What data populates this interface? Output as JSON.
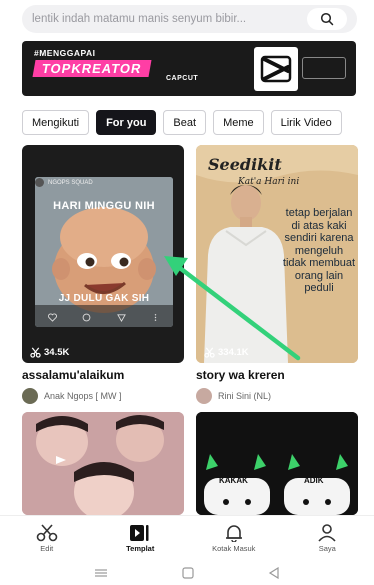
{
  "search": {
    "placeholder": "lentik indah matamu manis senyum bibir..."
  },
  "banner": {
    "hashtag": "#MENGGAPAI",
    "title": "TOPKREATOR",
    "brand": "CAPCUT"
  },
  "tabs": [
    {
      "label": "Mengikuti",
      "active": false
    },
    {
      "label": "For you",
      "active": true
    },
    {
      "label": "Beat",
      "active": false
    },
    {
      "label": "Meme",
      "active": false
    },
    {
      "label": "Lirik Video",
      "active": false
    }
  ],
  "cards": [
    {
      "title": "assalamu'alaikum",
      "views": "34.5K",
      "author": "Anak Ngops [ MW ]",
      "channel": "NGOPS SQUAD",
      "caption_top": "HARI MINGGU NIH",
      "caption_bottom": "JJ DULU GAK SIH"
    },
    {
      "title": "story wa kreren",
      "views": "334.1K",
      "author": "Rini Sini (NL)",
      "script_title": "Seedikit",
      "script_sub": "Kat'a Hari ini",
      "quote": "tetap berjalan di atas kaki sendiri karena mengeluh tidak membuat orang lain peduli"
    },
    {
      "title": "",
      "views": "",
      "author": ""
    },
    {
      "title": "",
      "views": "",
      "author": "",
      "label_left": "KAKAK",
      "label_right": "ADIK"
    }
  ],
  "nav": [
    {
      "label": "Edit",
      "icon": "scissors-icon",
      "active": false
    },
    {
      "label": "Templat",
      "icon": "template-icon",
      "active": true
    },
    {
      "label": "Kotak Masuk",
      "icon": "bell-icon",
      "active": false
    },
    {
      "label": "Saya",
      "icon": "person-icon",
      "active": false
    }
  ],
  "colors": {
    "accent": "#15151a",
    "banner_pink": "#ff3ea5",
    "arrow": "#33d17a"
  }
}
